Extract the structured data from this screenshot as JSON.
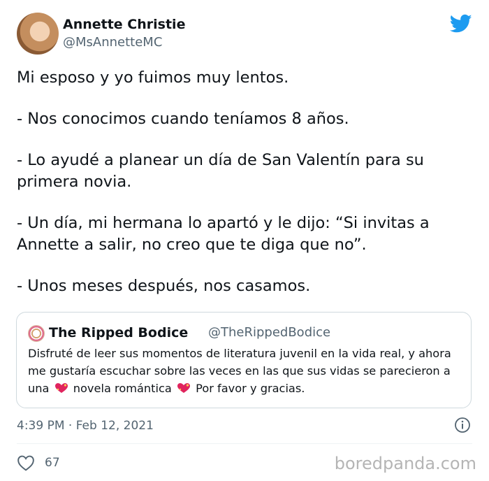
{
  "author": {
    "name": "Annette Christie",
    "handle": "@MsAnnetteMC"
  },
  "tweet": {
    "paragraphs": [
      "Mi esposo y yo fuimos muy lentos.",
      "- Nos conocimos cuando teníamos 8 años.",
      "- Lo ayudé a planear un día de San Valentín para su primera novia.",
      "- Un día, mi hermana lo apartó y le dijo: “Si invitas a Annette a salir, no creo que te diga que no”.",
      "- Unos meses después, nos casamos."
    ]
  },
  "quote": {
    "name": "The Ripped Bodice",
    "handle": "@TheRippedBodice",
    "text_part1": "Disfruté de leer sus momentos de literatura juvenil en la vida real, y ahora me gustaría escuchar sobre las veces en las que sus vidas se parecieron a una",
    "text_part2": "novela romántica",
    "text_part3": "Por favor y gracias.",
    "emoji_icon": "sparkling-heart-icon"
  },
  "meta": {
    "timestamp": "4:39 PM · Feb 12, 2021"
  },
  "engagement": {
    "likes": "67"
  },
  "watermark": "boredpanda.com",
  "colors": {
    "twitter_blue": "#1d9bf0",
    "text": "#0f1419",
    "secondary": "#536471",
    "border": "#cfd9de"
  }
}
